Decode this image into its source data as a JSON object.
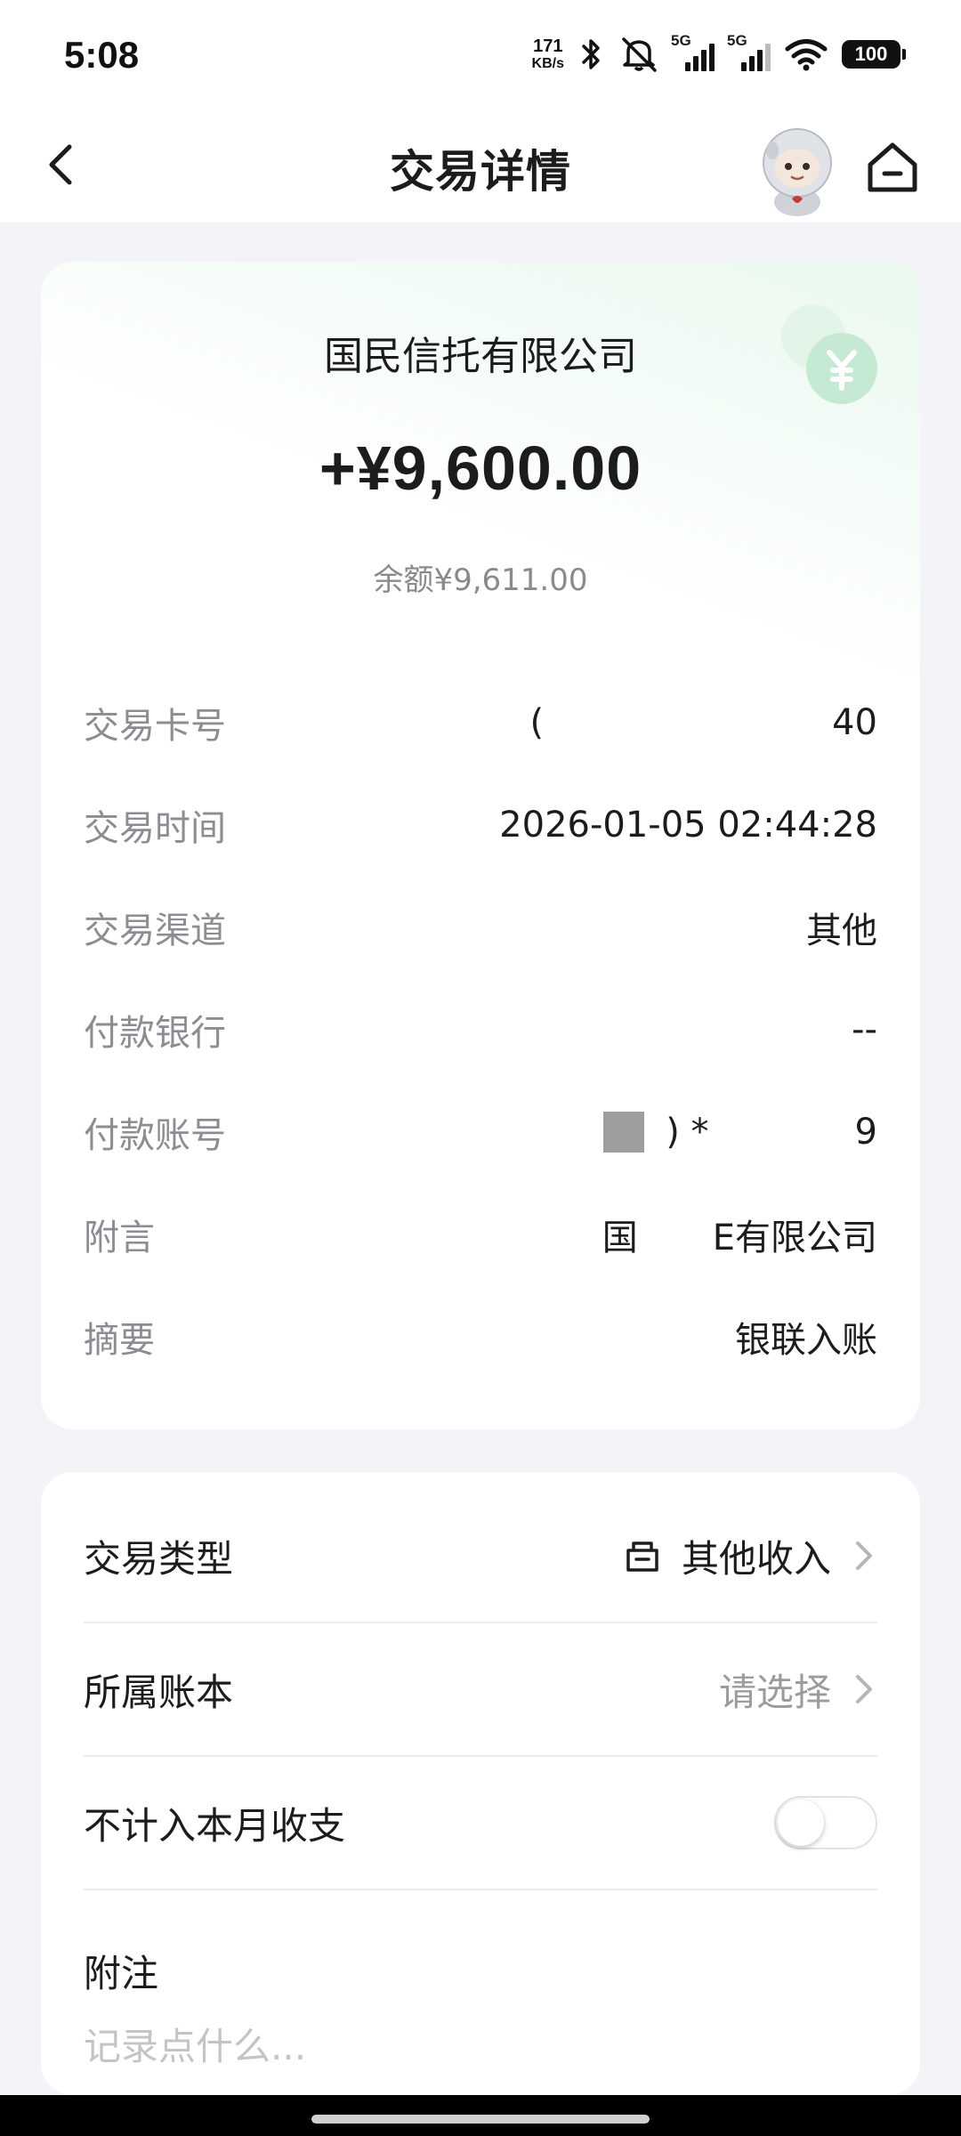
{
  "status_bar": {
    "time": "5:08",
    "net_speed_value": "171",
    "net_speed_unit": "KB/s",
    "sim1_label": "5G",
    "sim2_label": "5G",
    "battery": "100"
  },
  "header": {
    "title": "交易详情",
    "back_icon": "chevron-left-icon",
    "home_icon": "home-icon"
  },
  "transaction": {
    "merchant": "国民信托有限公司",
    "amount": "+¥9,600.00",
    "balance": "余额¥9,611.00",
    "accent_color": "#4cbb6c",
    "rows": [
      {
        "label": "交易卡号",
        "value_left": "(",
        "value_right": "40"
      },
      {
        "label": "交易时间",
        "value": "2026-01-05 02:44:28"
      },
      {
        "label": "交易渠道",
        "value": "其他"
      },
      {
        "label": "付款银行",
        "value": "--"
      },
      {
        "label": "付款账号",
        "value_left": ") *",
        "value_right": "9"
      },
      {
        "label": "附言",
        "value_left": "国",
        "value_right": "E有限公司"
      },
      {
        "label": "摘要",
        "value": "银联入账"
      }
    ]
  },
  "settings": {
    "type_label": "交易类型",
    "type_value": "其他收入",
    "book_label": "所属账本",
    "book_value": "请选择",
    "exclude_label": "不计入本月收支",
    "exclude_on": false,
    "note_label": "附注",
    "note_placeholder": "记录点什么..."
  }
}
